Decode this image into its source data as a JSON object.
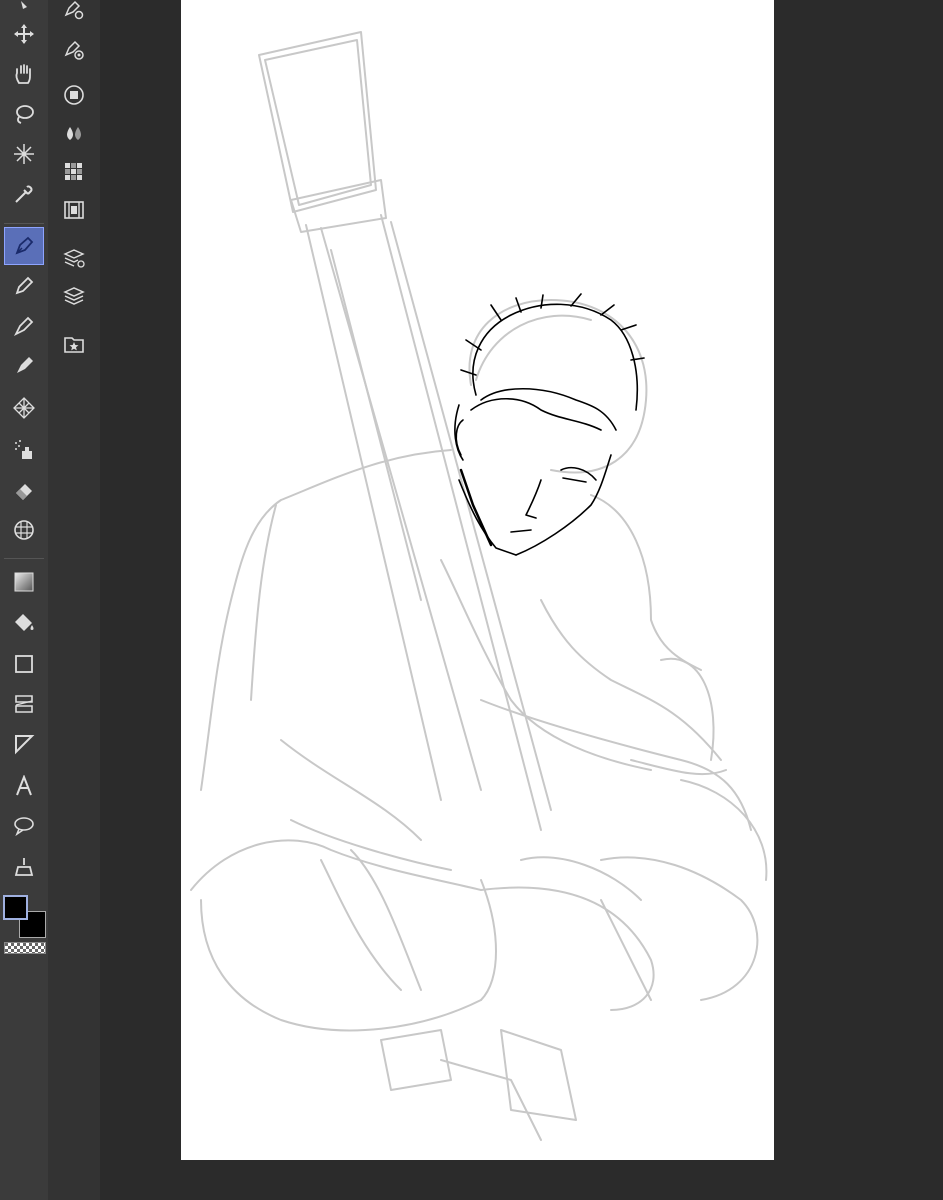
{
  "toolbar": {
    "tools": [
      {
        "name": "move-layer-tool",
        "icon": "move-arrows-icon",
        "active": false
      },
      {
        "name": "hand-tool",
        "icon": "hand-icon",
        "active": false
      },
      {
        "name": "lasso-tool",
        "icon": "lasso-icon",
        "active": false
      },
      {
        "name": "auto-select-tool",
        "icon": "magic-wand-icon",
        "active": false
      },
      {
        "name": "eyedropper-tool",
        "icon": "eyedropper-icon",
        "active": false
      },
      {
        "name": "pen-tool",
        "icon": "pen-nib-icon",
        "active": true
      },
      {
        "name": "pencil-tool",
        "icon": "pencil-icon",
        "active": false
      },
      {
        "name": "brush-tool",
        "icon": "brush-icon",
        "active": false
      },
      {
        "name": "marker-tool",
        "icon": "marker-icon",
        "active": false
      },
      {
        "name": "decoration-tool",
        "icon": "pattern-icon",
        "active": false
      },
      {
        "name": "airbrush-tool",
        "icon": "airbrush-icon",
        "active": false
      },
      {
        "name": "eraser-tool",
        "icon": "eraser-icon",
        "active": false
      },
      {
        "name": "blend-tool",
        "icon": "blend-grid-icon",
        "active": false
      },
      {
        "name": "gradient-tool",
        "icon": "gradient-icon",
        "active": false
      },
      {
        "name": "fill-tool",
        "icon": "paint-bucket-icon",
        "active": false
      },
      {
        "name": "rectangle-tool",
        "icon": "rectangle-icon",
        "active": false
      },
      {
        "name": "frame-tool",
        "icon": "frame-border-icon",
        "active": false
      },
      {
        "name": "ruler-tool",
        "icon": "ruler-triangle-icon",
        "active": false
      },
      {
        "name": "text-tool",
        "icon": "text-icon",
        "active": false
      },
      {
        "name": "balloon-tool",
        "icon": "speech-balloon-icon",
        "active": false
      },
      {
        "name": "correct-line-tool",
        "icon": "correct-line-icon",
        "active": false
      }
    ],
    "main_color": "#000000",
    "sub_color": "#000000",
    "accent": "#5a6fb8"
  },
  "subbar": {
    "items": [
      {
        "name": "pen-settings-button",
        "icon": "pen-gear-icon"
      },
      {
        "name": "pen-stabilizer-button",
        "icon": "pen-target-icon"
      },
      {
        "name": "color-circle-button",
        "icon": "color-circle-icon"
      },
      {
        "name": "color-mixing-button",
        "icon": "droplets-icon"
      },
      {
        "name": "color-set-button",
        "icon": "color-grid-icon"
      },
      {
        "name": "timeline-button",
        "icon": "film-icon"
      },
      {
        "name": "layer-property-button",
        "icon": "layer-settings-icon"
      },
      {
        "name": "layers-button",
        "icon": "layers-icon"
      },
      {
        "name": "materials-button",
        "icon": "star-folder-icon"
      }
    ]
  },
  "canvas": {
    "background": "#ffffff",
    "sketch_color": "#c8c8c8",
    "ink_color": "#000000"
  }
}
